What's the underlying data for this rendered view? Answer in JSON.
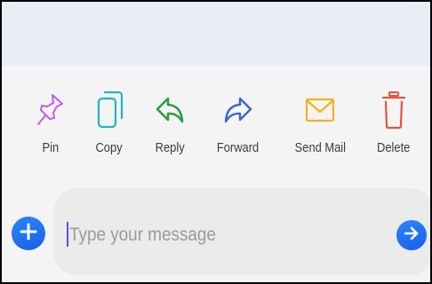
{
  "actions": [
    {
      "label": "Pin",
      "icon": "pin-icon",
      "color": "#c05cf0"
    },
    {
      "label": "Copy",
      "icon": "copy-icon",
      "color": "#1fb5c9"
    },
    {
      "label": "Reply",
      "icon": "reply-icon",
      "color": "#2e9e3e"
    },
    {
      "label": "Forward",
      "icon": "forward-icon",
      "color": "#3f66c4"
    },
    {
      "label": "Send Mail",
      "icon": "mail-icon",
      "color": "#f2b21a"
    },
    {
      "label": "Delete",
      "icon": "trash-icon",
      "color": "#e5533d"
    }
  ],
  "composer": {
    "placeholder": "Type your message",
    "accent": "#1e6ff2"
  }
}
